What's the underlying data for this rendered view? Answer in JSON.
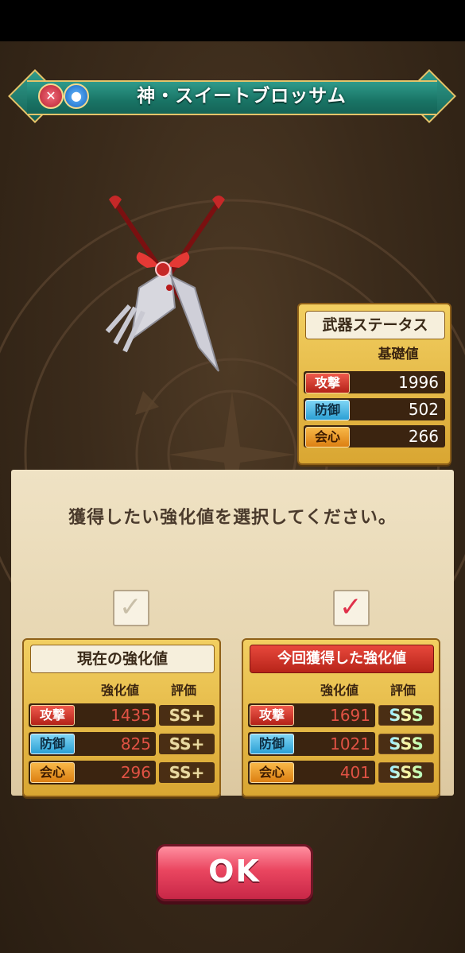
{
  "weapon": {
    "name": "神・スイートブロッサム",
    "type_icon": "fork-weapon-icon",
    "element_icon": "water-element-icon"
  },
  "weapon_status": {
    "title": "武器ステータス",
    "column_label": "基礎値",
    "rows": [
      {
        "label": "攻撃",
        "value": "1996"
      },
      {
        "label": "防御",
        "value": "502"
      },
      {
        "label": "会心",
        "value": "266"
      }
    ]
  },
  "selection": {
    "prompt": "獲得したい強化値を選択してください。",
    "current": {
      "title": "現在の強化値",
      "checked": false,
      "col_value": "強化値",
      "col_grade": "評価",
      "rows": [
        {
          "label": "攻撃",
          "value": "1435",
          "grade": "SS+"
        },
        {
          "label": "防御",
          "value": "825",
          "grade": "SS+"
        },
        {
          "label": "会心",
          "value": "296",
          "grade": "SS+"
        }
      ]
    },
    "new": {
      "title": "今回獲得した強化値",
      "checked": true,
      "col_value": "強化値",
      "col_grade": "評価",
      "rows": [
        {
          "label": "攻撃",
          "value": "1691",
          "grade": "SSS"
        },
        {
          "label": "防御",
          "value": "1021",
          "grade": "SSS"
        },
        {
          "label": "会心",
          "value": "401",
          "grade": "SSS"
        }
      ]
    }
  },
  "ok_button": "OK",
  "colors": {
    "banner": "#197465",
    "panel_gold": "#e8bd48",
    "header_red": "#c8342a",
    "value_red": "#d84a3a",
    "ok_pink": "#ea4660"
  }
}
